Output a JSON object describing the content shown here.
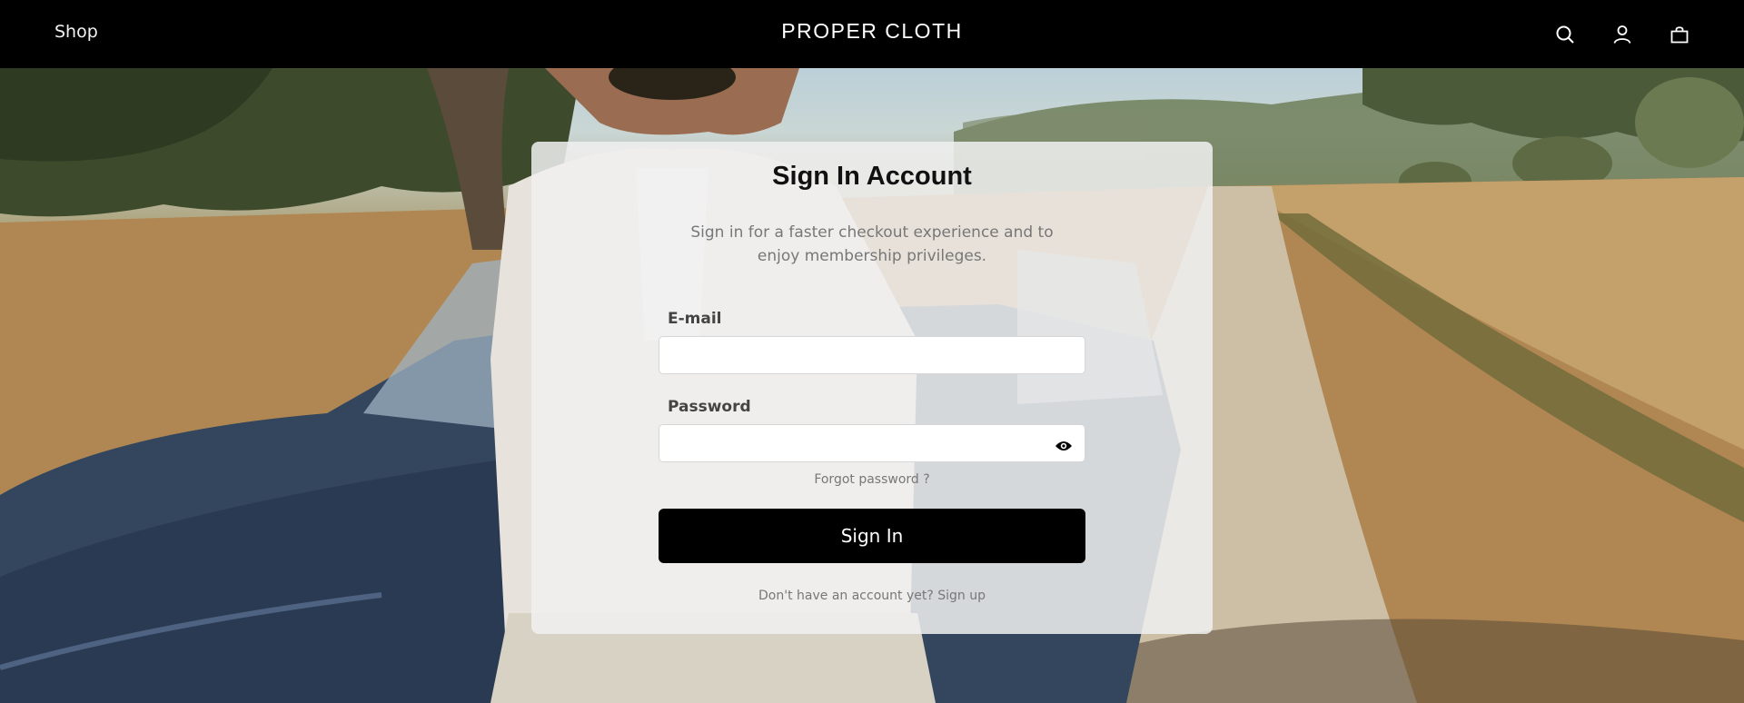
{
  "header": {
    "shop_label": "Shop",
    "brand": "PROPER CLOTH",
    "icons": [
      "search-icon",
      "account-icon",
      "bag-icon"
    ]
  },
  "card": {
    "title": "Sign In Account",
    "subtitle": "Sign in for a faster checkout experience and to enjoy membership privileges.",
    "email_label": "E-mail",
    "email_value": "",
    "password_label": "Password",
    "password_value": "",
    "forgot_label": "Forgot password ?",
    "submit_label": "Sign In",
    "signup_text": "Don't have an account yet? Sign up"
  },
  "colors": {
    "header_bg": "#000000",
    "button_bg": "#000000",
    "card_bg": "#f0f0f0"
  }
}
